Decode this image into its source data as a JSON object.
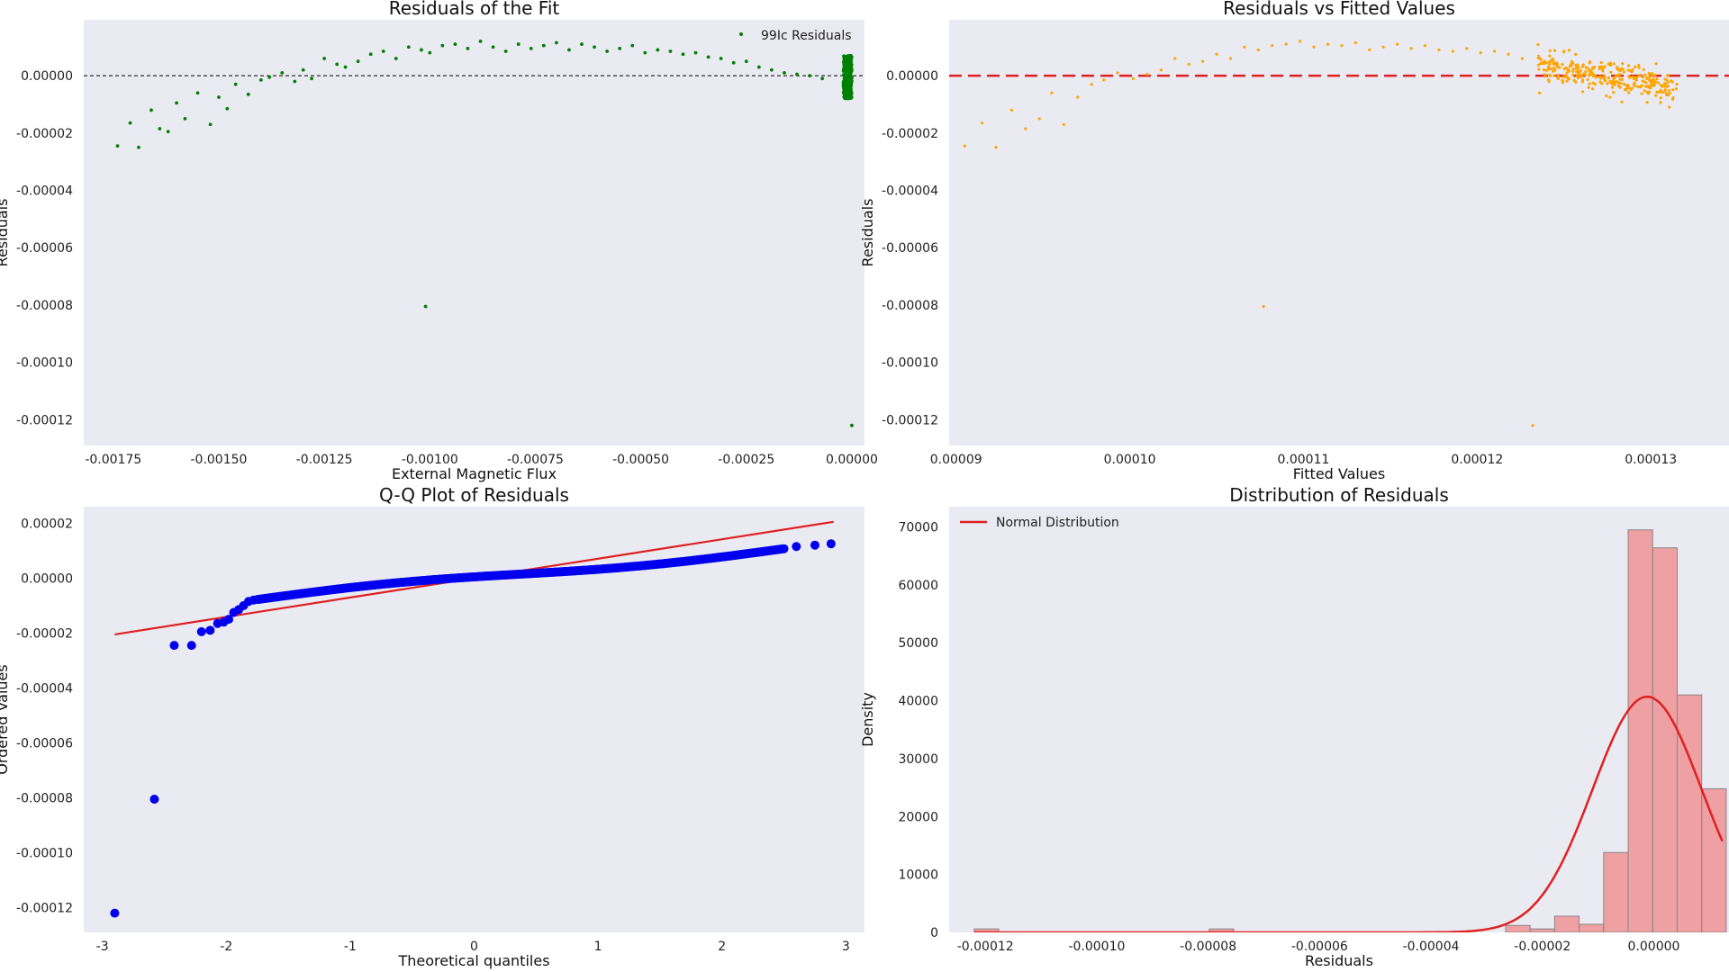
{
  "chart_data": [
    {
      "type": "scatter",
      "title": "Residuals of the Fit",
      "xlabel": "External Magnetic Flux",
      "ylabel": "Residuals",
      "xlim": [
        -0.00182,
        3e-05
      ],
      "ylim": [
        -0.000129,
        1.95e-05
      ],
      "xticks": [
        -0.00175,
        -0.0015,
        -0.00125,
        -0.001,
        -0.00075,
        -0.0005,
        -0.00025,
        0.0
      ],
      "xtick_labels": [
        "-0.00175",
        "-0.00150",
        "-0.00125",
        "-0.00100",
        "-0.00075",
        "-0.00050",
        "-0.00025",
        "0.00000"
      ],
      "yticks": [
        0.0,
        -2e-05,
        -4e-05,
        -6e-05,
        -8e-05,
        -0.0001,
        -0.00012
      ],
      "ytick_labels": [
        "0.00000",
        "-0.00002",
        "-0.00004",
        "-0.00006",
        "-0.00008",
        "-0.00010",
        "-0.00012"
      ],
      "hline": 0.0,
      "grid": false,
      "legend_position": "top-right",
      "series": [
        {
          "name": "99Ic Residuals",
          "color": "#008000",
          "x": [
            -0.00174,
            -0.00171,
            -0.00169,
            -0.00166,
            -0.00164,
            -0.00162,
            -0.0016,
            -0.00158,
            -0.00155,
            -0.00152,
            -0.0015,
            -0.00148,
            -0.00146,
            -0.00143,
            -0.0014,
            -0.00138,
            -0.00135,
            -0.00132,
            -0.0013,
            -0.00128,
            -0.00125,
            -0.00122,
            -0.0012,
            -0.00117,
            -0.00114,
            -0.00111,
            -0.00108,
            -0.00105,
            -0.00102,
            -0.001,
            -0.00097,
            -0.00094,
            -0.00091,
            -0.00088,
            -0.00085,
            -0.00082,
            -0.00079,
            -0.00076,
            -0.00073,
            -0.0007,
            -0.00067,
            -0.00064,
            -0.00061,
            -0.00058,
            -0.00055,
            -0.00052,
            -0.00049,
            -0.00046,
            -0.00043,
            -0.0004,
            -0.00037,
            -0.00034,
            -0.00031,
            -0.00028,
            -0.00025,
            -0.00022,
            -0.00019,
            -0.00016,
            -0.00013,
            -0.0001,
            -7e-05,
            -0.00101,
            0.0
          ],
          "y": [
            -2.45e-05,
            -1.65e-05,
            -2.5e-05,
            -1.2e-05,
            -1.85e-05,
            -1.95e-05,
            -9.5e-06,
            -1.5e-05,
            -6e-06,
            -1.7e-05,
            -7.5e-06,
            -1.15e-05,
            -3e-06,
            -6.5e-06,
            -1.5e-06,
            -5e-07,
            1e-06,
            -2e-06,
            2e-06,
            -1e-06,
            6e-06,
            4e-06,
            3e-06,
            5e-06,
            7.5e-06,
            8.5e-06,
            6e-06,
            1e-05,
            9e-06,
            8e-06,
            1.05e-05,
            1.1e-05,
            9.5e-06,
            1.2e-05,
            1e-05,
            8.5e-06,
            1.1e-05,
            9.5e-06,
            1.05e-05,
            1.15e-05,
            9e-06,
            1.1e-05,
            1e-05,
            8.5e-06,
            9.5e-06,
            1.05e-05,
            8e-06,
            9e-06,
            8.5e-06,
            7.5e-06,
            8e-06,
            6.5e-06,
            6e-06,
            4.5e-06,
            5e-06,
            3e-06,
            2e-06,
            1e-06,
            5e-07,
            0.0,
            -1e-06,
            -8.05e-05,
            -0.000122
          ],
          "dense_cluster": {
            "x_center": -1e-05,
            "x_spread": 1e-05,
            "y_range": [
              -8e-06,
              7e-06
            ],
            "count": 300
          }
        }
      ]
    },
    {
      "type": "scatter",
      "title": "Residuals vs Fitted Values",
      "xlabel": "Fitted Values",
      "ylabel": "Residuals",
      "xlim": [
        8.96e-05,
        0.0001345
      ],
      "ylim": [
        -0.000129,
        1.95e-05
      ],
      "xticks": [
        9e-05,
        0.0001,
        0.00011,
        0.00012,
        0.00013
      ],
      "xtick_labels": [
        "0.00009",
        "0.00010",
        "0.00011",
        "0.00012",
        "0.00013"
      ],
      "yticks": [
        0.0,
        -2e-05,
        -4e-05,
        -6e-05,
        -8e-05,
        -0.0001,
        -0.00012
      ],
      "ytick_labels": [
        "0.00000",
        "-0.00002",
        "-0.00004",
        "-0.00006",
        "-0.00008",
        "-0.00010",
        "-0.00012"
      ],
      "hline": 0.0,
      "hline_color": "#e02020",
      "grid": false,
      "series": [
        {
          "color": "#ffa500",
          "x": [
            9.05e-05,
            9.15e-05,
            9.23e-05,
            9.32e-05,
            9.4e-05,
            9.48e-05,
            9.55e-05,
            9.62e-05,
            9.7e-05,
            9.78e-05,
            9.85e-05,
            9.93e-05,
            0.0001002,
            0.000101,
            0.0001018,
            0.0001026,
            0.0001034,
            0.0001042,
            0.000105,
            0.0001058,
            0.0001066,
            0.0001074,
            0.0001082,
            0.000109,
            0.0001098,
            0.0001106,
            0.0001114,
            0.0001122,
            0.000113,
            0.0001138,
            0.0001146,
            0.0001154,
            0.0001162,
            0.000117,
            0.0001178,
            0.0001186,
            0.0001194,
            0.0001202,
            0.000121,
            0.0001218,
            0.0001226,
            0.0001077,
            0.0001232
          ],
          "y": [
            -2.45e-05,
            -1.65e-05,
            -2.5e-05,
            -1.2e-05,
            -1.85e-05,
            -1.5e-05,
            -6e-06,
            -1.7e-05,
            -7.5e-06,
            -3e-06,
            -1.5e-06,
            1e-06,
            -1e-06,
            5e-07,
            2e-06,
            6e-06,
            4e-06,
            5e-06,
            7.5e-06,
            6e-06,
            1e-05,
            9e-06,
            1.05e-05,
            1.1e-05,
            1.2e-05,
            1e-05,
            1.1e-05,
            1.05e-05,
            1.15e-05,
            9e-06,
            1e-05,
            1.1e-05,
            9.5e-06,
            1.05e-05,
            9e-06,
            8.5e-06,
            9.5e-06,
            8e-06,
            8.5e-06,
            7.5e-06,
            6e-06,
            -8.05e-05,
            -0.000122
          ],
          "dense_cluster": {
            "x_range": [
              0.0001235,
              0.0001315
            ],
            "y_center_start": 3.5e-06,
            "y_center_end": -4.5e-06,
            "y_spread": 6e-06,
            "count": 300
          }
        }
      ]
    },
    {
      "type": "scatter",
      "title": "Q-Q Plot of Residuals",
      "xlabel": "Theoretical quantiles",
      "ylabel": "Ordered Values",
      "xlim": [
        -3.15,
        3.15
      ],
      "ylim": [
        -0.000129,
        2.6e-05
      ],
      "xticks": [
        -3,
        -2,
        -1,
        0,
        1,
        2,
        3
      ],
      "xtick_labels": [
        "-3",
        "-2",
        "-1",
        "0",
        "1",
        "2",
        "3"
      ],
      "yticks": [
        2e-05,
        0.0,
        -2e-05,
        -4e-05,
        -6e-05,
        -8e-05,
        -0.0001,
        -0.00012
      ],
      "ytick_labels": [
        "0.00002",
        "0.00000",
        "-0.00002",
        "-0.00004",
        "-0.00006",
        "-0.00008",
        "-0.00010",
        "-0.00012"
      ],
      "grid": false,
      "fit_line": {
        "x": [
          -2.9,
          2.9
        ],
        "y": [
          -2.05e-05,
          2.05e-05
        ],
        "color": "#e02020"
      },
      "series": [
        {
          "color": "#0000ee",
          "x": [
            -2.9,
            -2.58,
            -2.42,
            -2.28,
            -2.2,
            -2.13,
            -2.07,
            -2.02,
            -1.98,
            -1.94,
            -1.9,
            -1.86,
            -1.82,
            -1.78,
            2.6,
            2.75,
            2.88
          ],
          "y": [
            -0.000122,
            -8.05e-05,
            -2.45e-05,
            -2.45e-05,
            -1.95e-05,
            -1.9e-05,
            -1.65e-05,
            -1.6e-05,
            -1.5e-05,
            -1.25e-05,
            -1.15e-05,
            -1e-05,
            -8.5e-06,
            -8e-06,
            1.15e-05,
            1.2e-05,
            1.25e-05
          ],
          "dense_curve": {
            "x_range": [
              -1.75,
              2.5
            ],
            "y_at_start": -7.8e-06,
            "y_at_end": 1.07e-05,
            "count": 400
          }
        }
      ]
    },
    {
      "type": "bar",
      "title": "Distribution of Residuals",
      "xlabel": "Residuals",
      "ylabel": "Density",
      "xlim": [
        -0.0001265,
        1.35e-05
      ],
      "ylim": [
        0,
        73500
      ],
      "xticks": [
        -0.00012,
        -0.0001,
        -8e-05,
        -6e-05,
        -4e-05,
        -2e-05,
        0.0
      ],
      "xtick_labels": [
        "-0.00012",
        "-0.00010",
        "-0.00008",
        "-0.00006",
        "-0.00004",
        "-0.00002",
        "0.00000"
      ],
      "yticks": [
        0,
        10000,
        20000,
        30000,
        40000,
        50000,
        60000,
        70000
      ],
      "ytick_labels": [
        "0",
        "10000",
        "20000",
        "30000",
        "40000",
        "50000",
        "60000",
        "70000"
      ],
      "grid": false,
      "legend_position": "top-left",
      "bar_color": "#f08080",
      "bins": {
        "left_edges": [
          -0.000122,
          -7.98e-05,
          -2.66e-05,
          -2.22e-05,
          -1.78e-05,
          -1.34e-05,
          -9e-06,
          -4.6e-06,
          -2e-07,
          4.2e-06,
          8.6e-06
        ],
        "width": 4.4e-06,
        "values": [
          600,
          600,
          1200,
          600,
          2800,
          1400,
          13800,
          69500,
          66400,
          41000,
          24800
        ]
      },
      "normal_curve": {
        "name": "Normal Distribution",
        "color": "#e02020",
        "mean": -1.2e-06,
        "std": 9.8e-06,
        "peak": 40700,
        "x_range": [
          -0.000122,
          1.23e-05
        ]
      }
    }
  ]
}
